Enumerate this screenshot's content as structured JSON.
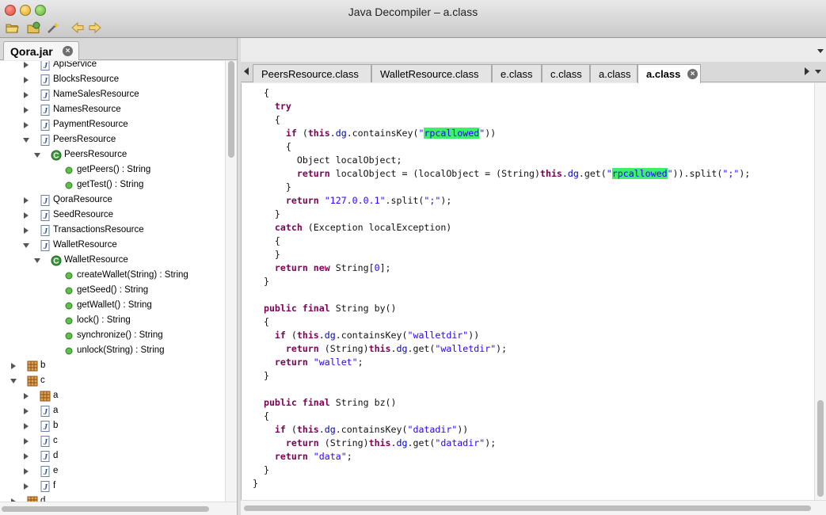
{
  "window": {
    "title": "Java Decompiler – a.class"
  },
  "toolbar": {
    "open_icon": "open-folder-icon",
    "open_type_icon": "open-type-icon",
    "search_icon": "wand-icon",
    "back_icon": "back-arrow-icon",
    "forward_icon": "forward-arrow-icon"
  },
  "left_tab": {
    "label": "Qora.jar"
  },
  "tree": {
    "items": [
      {
        "label": "ApiService",
        "kind": "file"
      },
      {
        "label": "BlocksResource",
        "kind": "file"
      },
      {
        "label": "NameSalesResource",
        "kind": "file"
      },
      {
        "label": "NamesResource",
        "kind": "file"
      },
      {
        "label": "PaymentResource",
        "kind": "file"
      },
      {
        "label": "PeersResource",
        "kind": "file"
      },
      {
        "label": "PeersResource",
        "kind": "class"
      },
      {
        "label": "getPeers() : String",
        "kind": "method"
      },
      {
        "label": "getTest() : String",
        "kind": "method"
      },
      {
        "label": "QoraResource",
        "kind": "file"
      },
      {
        "label": "SeedResource",
        "kind": "file"
      },
      {
        "label": "TransactionsResource",
        "kind": "file"
      },
      {
        "label": "WalletResource",
        "kind": "file"
      },
      {
        "label": "WalletResource",
        "kind": "class"
      },
      {
        "label": "createWallet(String) : String",
        "kind": "method"
      },
      {
        "label": "getSeed() : String",
        "kind": "method"
      },
      {
        "label": "getWallet() : String",
        "kind": "method"
      },
      {
        "label": "lock() : String",
        "kind": "method"
      },
      {
        "label": "synchronize() : String",
        "kind": "method"
      },
      {
        "label": "unlock(String) : String",
        "kind": "method"
      },
      {
        "label": "b",
        "kind": "package"
      },
      {
        "label": "c",
        "kind": "package"
      },
      {
        "label": "a",
        "kind": "package"
      },
      {
        "label": "a",
        "kind": "file"
      },
      {
        "label": "b",
        "kind": "file"
      },
      {
        "label": "c",
        "kind": "file"
      },
      {
        "label": "d",
        "kind": "file"
      },
      {
        "label": "e",
        "kind": "file"
      },
      {
        "label": "f",
        "kind": "file"
      },
      {
        "label": "d",
        "kind": "package"
      }
    ]
  },
  "editor_tabs": [
    {
      "label": "PeersResource.class"
    },
    {
      "label": "WalletResource.class"
    },
    {
      "label": "e.class"
    },
    {
      "label": "c.class"
    },
    {
      "label": "a.class"
    },
    {
      "label": "a.class",
      "active": true
    }
  ],
  "code": {
    "lines": [
      "  {",
      "    try",
      "    {",
      "      if (this.dg.containsKey(\"rpcallowed\"))",
      "      {",
      "        Object localObject;",
      "        return localObject = (localObject = (String)this.dg.get(\"rpcallowed\")).split(\";\");",
      "      }",
      "      return \"127.0.0.1\".split(\";\");",
      "    }",
      "    catch (Exception localException)",
      "    {",
      "    }",
      "    return new String[0];",
      "  }",
      "",
      "  public final String by()",
      "  {",
      "    if (this.dg.containsKey(\"walletdir\"))",
      "      return (String)this.dg.get(\"walletdir\");",
      "    return \"wallet\";",
      "  }",
      "",
      "  public final String bz()",
      "  {",
      "    if (this.dg.containsKey(\"datadir\"))",
      "      return (String)this.dg.get(\"datadir\");",
      "    return \"data\";",
      "  }",
      "}"
    ]
  },
  "colors": {
    "keyword": "#7f0055",
    "string": "#2a00ff",
    "field": "#0000c0",
    "highlight": "#3cf06c"
  }
}
